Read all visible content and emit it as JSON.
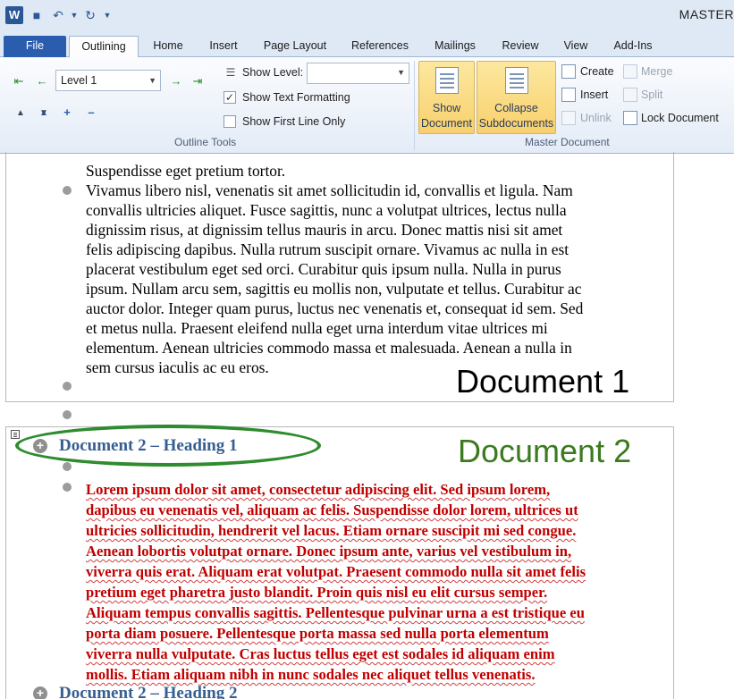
{
  "window": {
    "title": "MASTER"
  },
  "quick_access": {
    "app_icon": "word-icon",
    "buttons": [
      "save-icon",
      "undo-icon",
      "dropdown-icon",
      "redo-icon",
      "customize-icon"
    ],
    "app_letter": "W"
  },
  "tabs": [
    {
      "label": "File"
    },
    {
      "label": "Outlining",
      "active": true
    },
    {
      "label": "Home"
    },
    {
      "label": "Insert"
    },
    {
      "label": "Page Layout"
    },
    {
      "label": "References"
    },
    {
      "label": "Mailings"
    },
    {
      "label": "Review"
    },
    {
      "label": "View"
    },
    {
      "label": "Add-Ins"
    }
  ],
  "outline_tools": {
    "group_label": "Outline Tools",
    "level_value": "Level 1",
    "show_level_label": "Show Level:",
    "show_level_value": "",
    "show_text_formatting_label": "Show Text Formatting",
    "show_text_formatting_checked": true,
    "show_first_line_only_label": "Show First Line Only",
    "show_first_line_only_checked": false
  },
  "master_document": {
    "group_label": "Master Document",
    "show_document_label": "Show\nDocument",
    "collapse_subdocuments_label": "Collapse\nSubdocuments",
    "create_label": "Create",
    "insert_label": "Insert",
    "unlink_label": "Unlink",
    "merge_label": "Merge",
    "split_label": "Split",
    "lock_document_label": "Lock Document"
  },
  "document": {
    "top_paragraph_first_line": "Suspendisse eget pretium tortor.",
    "paragraph_1_lines": [
      "Vivamus libero nisl, venenatis sit amet sollicitudin id, convallis et ligula. Nam",
      "convallis ultricies aliquet. Fusce sagittis, nunc a volutpat ultrices, lectus nulla",
      "dignissim risus, at dignissim tellus mauris in arcu. Donec mattis nisi sit amet",
      "felis adipiscing dapibus. Nulla rutrum suscipit ornare. Vivamus ac nulla in est",
      "placerat vestibulum eget sed orci. Curabitur quis ipsum nulla. Nulla in purus",
      "ipsum. Nullam arcu sem, sagittis eu mollis non, vulputate et tellus. Curabitur ac",
      "auctor dolor. Integer quam purus, luctus nec venenatis et, consequat id sem. Sed",
      "et metus nulla. Praesent eleifend nulla eget urna interdum vitae ultrices mi",
      "elementum. Aenean ultricies commodo massa et malesuada. Aenean a nulla in",
      "sem cursus iaculis ac eu eros."
    ],
    "doc1_label": "Document 1",
    "doc1_label_color": "#000000",
    "doc2_heading": "Document 2 – Heading 1",
    "doc2_label": "Document 2",
    "doc2_label_color": "#3c7a1e",
    "doc2_paragraph_lines": [
      "Lorem ipsum dolor sit amet, consectetur adipiscing elit. Sed ipsum lorem,",
      "dapibus eu venenatis vel, aliquam ac felis. Suspendisse dolor lorem, ultrices ut",
      "ultricies sollicitudin, hendrerit vel lacus. Etiam ornare suscipit mi sed congue.",
      "Aenean lobortis volutpat ornare. Donec ipsum ante, varius vel vestibulum in,",
      "viverra quis erat. Aliquam erat volutpat. Praesent commodo nulla sit amet felis",
      "pretium eget pharetra justo blandit. Proin quis nisl eu elit cursus semper.",
      "Aliquam tempus convallis sagittis. Pellentesque pulvinar urna a est tristique eu",
      "porta diam posuere. Pellentesque porta massa sed nulla porta elementum",
      "viverra nulla vulputate. Cras luctus tellus eget est sodales id aliquam enim",
      "mollis. Etiam aliquam nibh in nunc sodales nec aliquet tellus venenatis."
    ],
    "doc2_heading_2": "Document 2 – Heading 2"
  }
}
